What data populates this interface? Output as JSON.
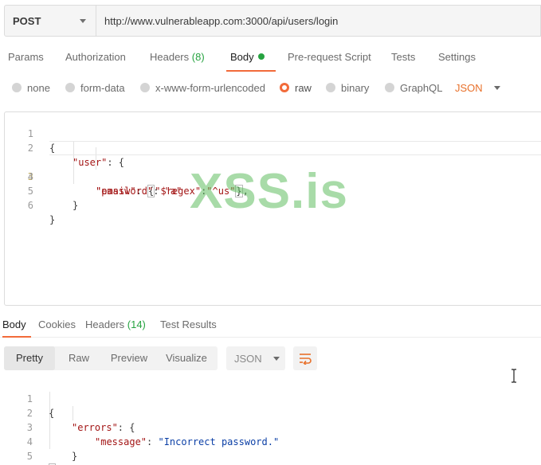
{
  "request": {
    "method": "POST",
    "url": "http://www.vulnerableapp.com:3000/api/users/login"
  },
  "request_tabs": [
    {
      "label": "Params"
    },
    {
      "label": "Authorization"
    },
    {
      "label": "Headers",
      "count": "(8)"
    },
    {
      "label": "Body",
      "active": true
    },
    {
      "label": "Pre-request Script"
    },
    {
      "label": "Tests"
    },
    {
      "label": "Settings"
    }
  ],
  "body_types": [
    {
      "label": "none"
    },
    {
      "label": "form-data"
    },
    {
      "label": "x-www-form-urlencoded"
    },
    {
      "label": "raw",
      "selected": true
    },
    {
      "label": "binary"
    },
    {
      "label": "GraphQL"
    }
  ],
  "body_format": "JSON",
  "request_body": {
    "line_numbers": [
      "1",
      "2",
      "3",
      "4",
      "5",
      "6"
    ],
    "lines": {
      "l1": "{",
      "l2_key": "\"user\"",
      "l2_rest": ": {",
      "l3_key": "\"email\"",
      "l3_colon": ": ",
      "l3_open": "{",
      "l3_k2": "\"$regex\"",
      "l3_colon2": ":",
      "l3_val": "\"^us\"",
      "l3_close": "}",
      "l3_end": ",",
      "l4_key": "\"password\"",
      "l4_colon": ": ",
      "l4_val": "\"a\"",
      "l5": "}",
      "l6": "}"
    }
  },
  "watermark": "XSS.is",
  "response_tabs": [
    {
      "label": "Body",
      "active": true
    },
    {
      "label": "Cookies"
    },
    {
      "label": "Headers",
      "count": "(14)"
    },
    {
      "label": "Test Results"
    }
  ],
  "response_view_modes": [
    "Pretty",
    "Raw",
    "Preview",
    "Visualize"
  ],
  "response_format": "JSON",
  "response_body": {
    "line_numbers": [
      "1",
      "2",
      "3",
      "4",
      "5"
    ],
    "lines": {
      "l1": "{",
      "l2_key": "\"errors\"",
      "l2_rest": ": {",
      "l3_key": "\"message\"",
      "l3_colon": ": ",
      "l3_val": "\"Incorrect password.\"",
      "l4": "}",
      "l5": "}"
    }
  },
  "colors": {
    "accent": "#f26b3a",
    "count_green": "#26a340",
    "json_string": "#a31515"
  }
}
